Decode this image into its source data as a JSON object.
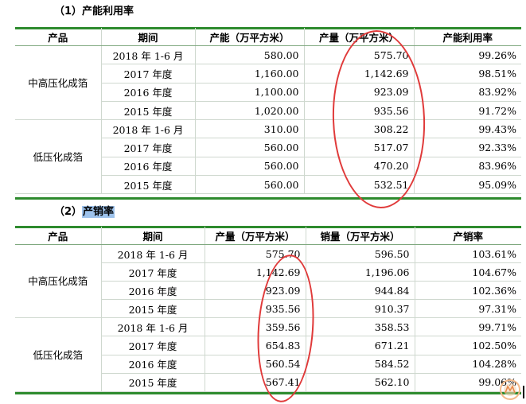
{
  "sections": [
    {
      "title_prefix": "（1）",
      "title_text": "产能利用率",
      "headers": [
        "产品",
        "期间",
        "产能（万平方米）",
        "产量（万平方米）",
        "产能利用率"
      ],
      "groups": [
        {
          "product": "中高压化成箔",
          "rows": [
            [
              "2018 年 1-6 月",
              "580.00",
              "575.70",
              "99.26%"
            ],
            [
              "2017 年度",
              "1,160.00",
              "1,142.69",
              "98.51%"
            ],
            [
              "2016 年度",
              "1,100.00",
              "923.09",
              "83.92%"
            ],
            [
              "2015 年度",
              "1,020.00",
              "935.56",
              "91.72%"
            ]
          ]
        },
        {
          "product": "低压化成箔",
          "rows": [
            [
              "2018 年 1-6 月",
              "310.00",
              "308.22",
              "99.43%"
            ],
            [
              "2017 年度",
              "560.00",
              "517.07",
              "92.33%"
            ],
            [
              "2016 年度",
              "560.00",
              "470.20",
              "83.96%"
            ],
            [
              "2015 年度",
              "560.00",
              "532.51",
              "95.09%"
            ]
          ]
        }
      ]
    },
    {
      "title_prefix": "（2）",
      "title_text": "产销率",
      "headers": [
        "产品",
        "期间",
        "产量（万平方米）",
        "销量（万平方米）",
        "产销率"
      ],
      "groups": [
        {
          "product": "中高压化成箔",
          "rows": [
            [
              "2018 年 1-6 月",
              "575.70",
              "596.50",
              "103.61%"
            ],
            [
              "2017 年度",
              "1,142.69",
              "1,196.06",
              "104.67%"
            ],
            [
              "2016 年度",
              "923.09",
              "944.84",
              "102.36%"
            ],
            [
              "2015 年度",
              "935.56",
              "910.37",
              "97.31%"
            ]
          ]
        },
        {
          "product": "低压化成箔",
          "rows": [
            [
              "2018 年 1-6 月",
              "359.56",
              "358.53",
              "99.71%"
            ],
            [
              "2017 年度",
              "654.83",
              "671.21",
              "102.50%"
            ],
            [
              "2016 年度",
              "560.54",
              "584.52",
              "104.28%"
            ],
            [
              "2015 年度",
              "567.41",
              "562.10",
              "99.06%"
            ]
          ]
        }
      ]
    }
  ],
  "colors": {
    "green_rule": "#2e8b2e",
    "red_annotation": "#e03a3a",
    "title_highlight": "#9ec3ec"
  },
  "watermark_icon": "mr-logo-icon"
}
